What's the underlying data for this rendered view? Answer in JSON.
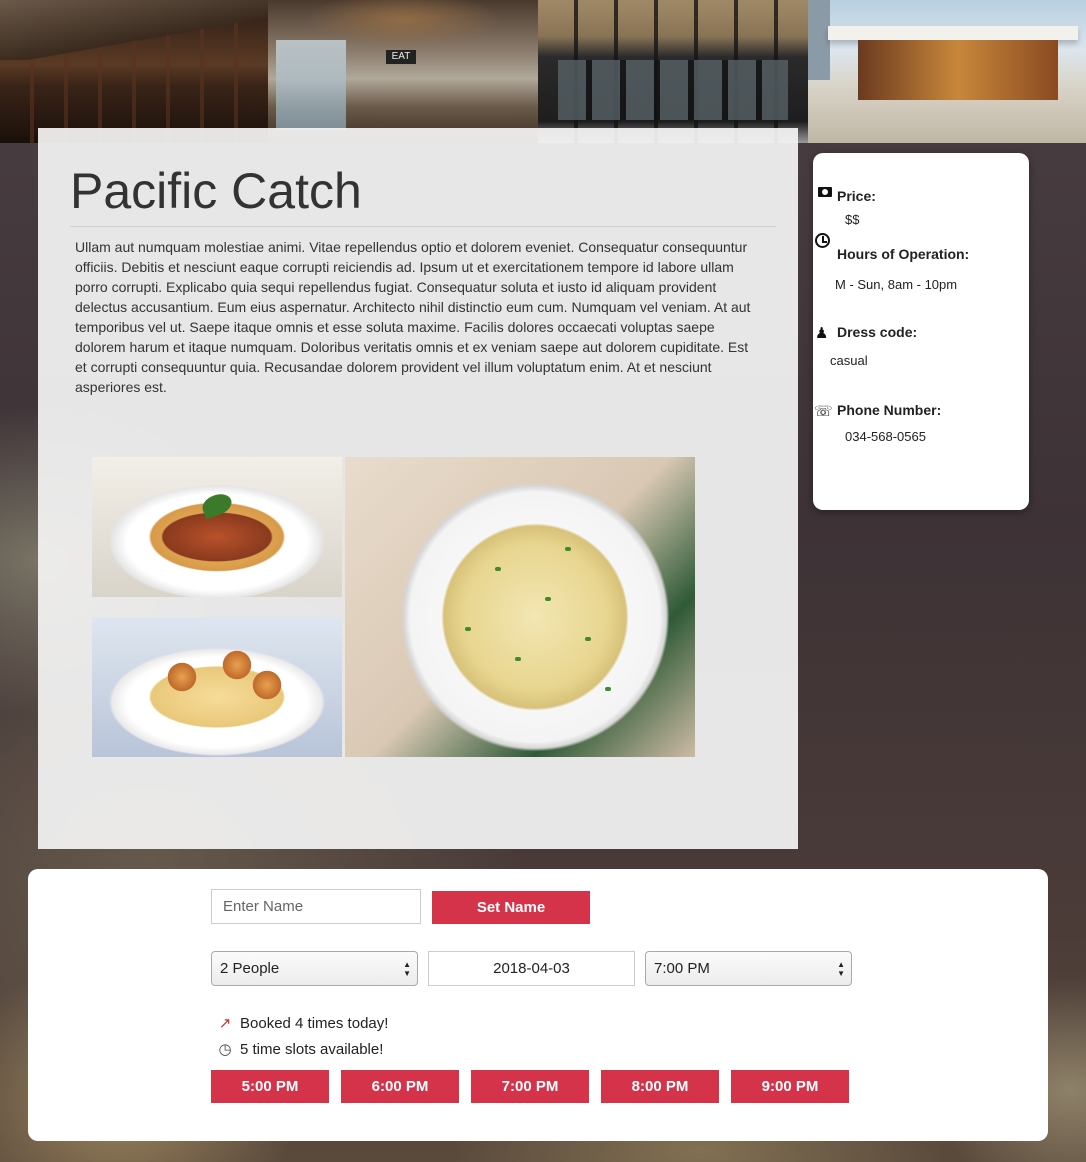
{
  "restaurant": {
    "name": "Pacific Catch",
    "description": "Ullam aut numquam molestiae animi. Vitae repellendus optio et dolorem eveniet. Consequatur consequuntur officiis. Debitis et nesciunt eaque corrupti reiciendis ad. Ipsum ut et exercitationem tempore id labore ullam porro corrupti. Explicabo quia sequi repellendus fugiat. Consequatur soluta et iusto id aliquam provident delectus accusantium. Eum eius aspernatur. Architecto nihil distinctio eum cum. Numquam vel veniam. At aut temporibus vel ut. Saepe itaque omnis et esse soluta maxime. Facilis dolores occaecati voluptas saepe dolorem harum et itaque numquam. Doloribus veritatis omnis et ex veniam saepe aut dolorem cupiditate. Est et corrupti consequuntur quia. Recusandae dolorem provident vel illum voluptatum enim. At et nesciunt asperiores est."
  },
  "header_photos": {
    "p2_sign": "EAT"
  },
  "info": {
    "price_label": "Price:",
    "price_value": "$$",
    "hours_label": "Hours of Operation:",
    "hours_value": "M - Sun, 8am - 10pm",
    "dress_label": "Dress code:",
    "dress_value": "casual",
    "phone_label": "Phone Number:",
    "phone_value": "034-568-0565"
  },
  "icons": {
    "price": "money-icon",
    "hours": "clock-icon",
    "dress": "dress-icon",
    "phone": "telephone-icon",
    "booked": "chart-increasing-icon",
    "slots": "clock-emoji-icon"
  },
  "booking": {
    "name_placeholder": "Enter Name",
    "set_name_label": "Set Name",
    "party_size": "2 People",
    "date": "2018-04-03",
    "time": "7:00 PM",
    "booked_text": "Booked 4 times today!",
    "slots_text": "5 time slots available!",
    "slots": [
      "5:00 PM",
      "6:00 PM",
      "7:00 PM",
      "8:00 PM",
      "9:00 PM"
    ]
  },
  "colors": {
    "accent": "#d5334a"
  }
}
